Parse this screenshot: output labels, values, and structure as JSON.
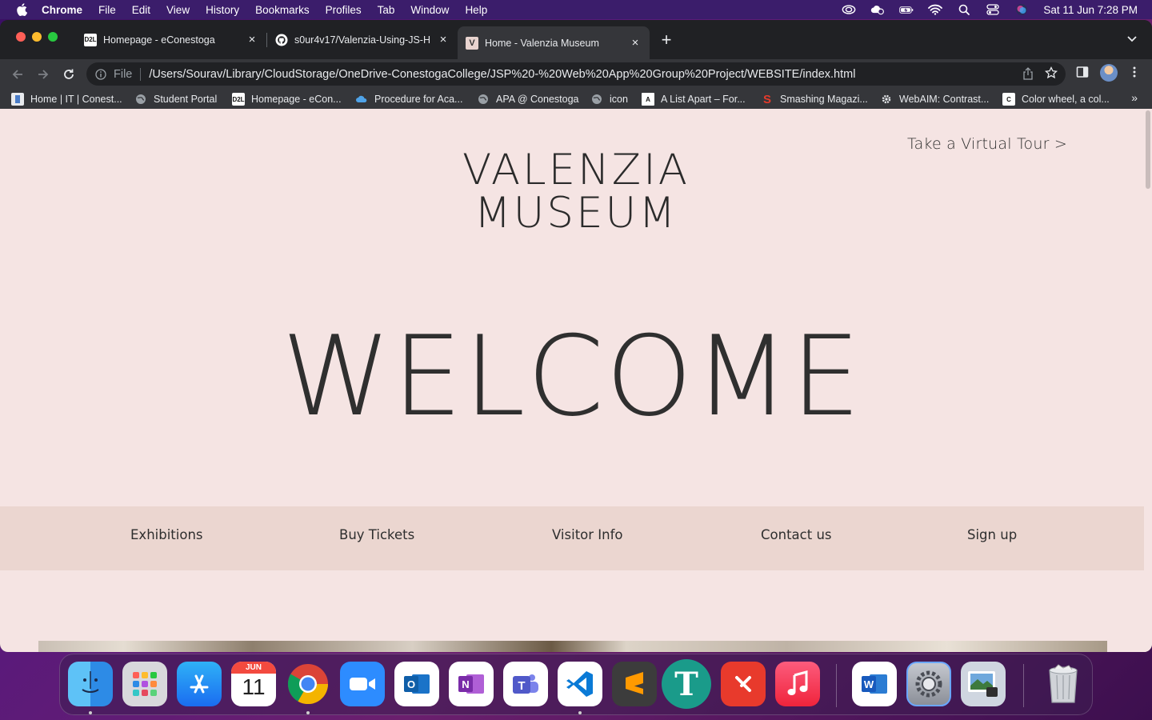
{
  "menubar": {
    "app_name": "Chrome",
    "items": [
      "File",
      "Edit",
      "View",
      "History",
      "Bookmarks",
      "Profiles",
      "Tab",
      "Window",
      "Help"
    ],
    "clock": "Sat 11 Jun  7:28 PM"
  },
  "tabs": [
    {
      "title": "Homepage - eConestoga",
      "favicon": "D2L"
    },
    {
      "title": "s0ur4v17/Valenzia-Using-JS-H",
      "favicon": "github-icon"
    },
    {
      "title": "Home - Valenzia Museum",
      "favicon": "V",
      "active": true
    }
  ],
  "omnibox": {
    "scheme": "File",
    "url": "/Users/Sourav/Library/CloudStorage/OneDrive-ConestogaCollege/JSP%20-%20Web%20App%20Group%20Project/WEBSITE/index.html"
  },
  "bookmarks": [
    "Home | IT | Conest...",
    "Student Portal",
    "Homepage - eCon...",
    "Procedure for Aca...",
    "APA @ Conestoga",
    "icon",
    "A List Apart – For...",
    "Smashing Magazi...",
    "WebAIM: Contrast...",
    "Color wheel, a col..."
  ],
  "page": {
    "tour_link": "Take a Virtual Tour >",
    "logo_line1": "VALENZIA",
    "logo_line2": "MUSEUM",
    "welcome": "WELCOME",
    "nav": [
      "Exhibitions",
      "Buy Tickets",
      "Visitor Info",
      "Contact us",
      "Sign up"
    ]
  },
  "dock": {
    "calendar_month": "JUN",
    "calendar_day": "11",
    "apps": [
      "finder",
      "launchpad",
      "app-store",
      "calendar",
      "chrome",
      "zoom",
      "outlook",
      "onenote",
      "teams",
      "vscode",
      "sublime-text",
      "typora",
      "remote-desktop",
      "music",
      "word",
      "system-preferences",
      "preview",
      "trash"
    ]
  },
  "colors": {
    "page_bg": "#f5e4e3",
    "nav_bg": "#ebd6d0",
    "text_dark": "#2f2f2f"
  }
}
